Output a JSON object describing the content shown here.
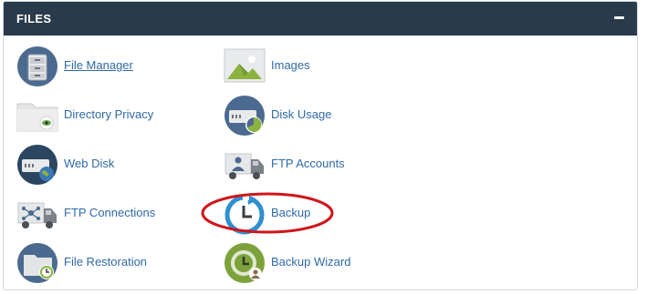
{
  "panel": {
    "title": "FILES",
    "collapse_symbol": "minus-icon"
  },
  "colors": {
    "header_bg": "#293a4a",
    "link": "#2f6aa6",
    "highlight": "#d0141b"
  },
  "items": [
    {
      "label": "File Manager",
      "icon": "file-cabinet-icon",
      "underlined": true
    },
    {
      "label": "Images",
      "icon": "image-icon"
    },
    {
      "label": "Directory Privacy",
      "icon": "folder-eye-icon"
    },
    {
      "label": "Disk Usage",
      "icon": "disk-usage-icon"
    },
    {
      "label": "Web Disk",
      "icon": "web-disk-icon"
    },
    {
      "label": "FTP Accounts",
      "icon": "ftp-accounts-truck-icon"
    },
    {
      "label": "FTP Connections",
      "icon": "ftp-connections-truck-icon"
    },
    {
      "label": "Backup",
      "icon": "backup-clock-icon",
      "highlighted": true
    },
    {
      "label": "File Restoration",
      "icon": "file-restoration-icon"
    },
    {
      "label": "Backup Wizard",
      "icon": "backup-wizard-icon"
    }
  ]
}
